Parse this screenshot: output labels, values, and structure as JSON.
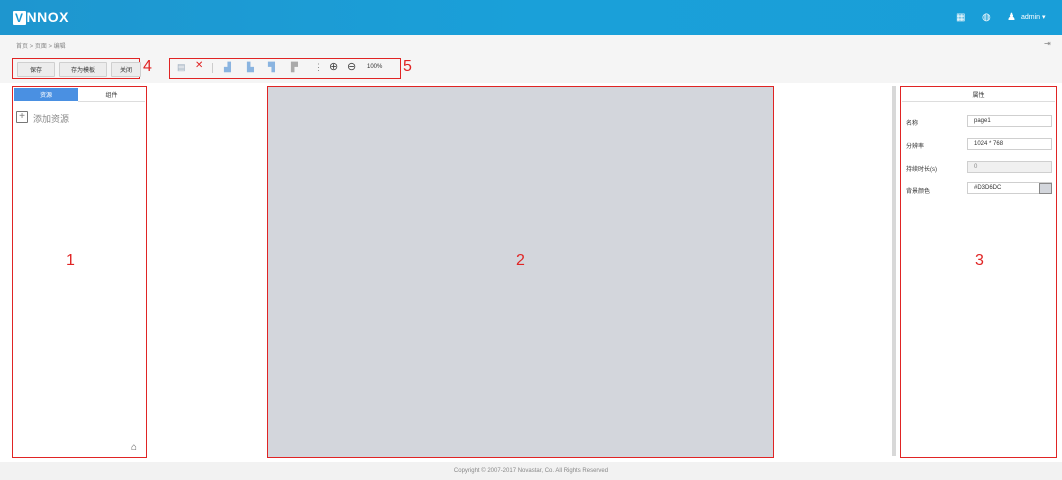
{
  "app": {
    "logo_prefix": "V",
    "logo_text": "NNOX",
    "user": "admin"
  },
  "breadcrumb": "首页 > 页面 > 编辑",
  "toolbar": {
    "save_label": "保存",
    "save_template_label": "存为模板",
    "close_label": "关闭",
    "zoom_level": "100%"
  },
  "left_panel": {
    "tabs": [
      {
        "label": "资源"
      },
      {
        "label": "组件"
      }
    ],
    "add_resource_label": "添加资源"
  },
  "right_panel": {
    "title": "属性",
    "props": [
      {
        "label": "名称",
        "value": "page1"
      },
      {
        "label": "分辨率",
        "value": "1024 * 768"
      },
      {
        "label": "持续时长(s)",
        "value": "0"
      },
      {
        "label": "背景颜色",
        "value": "#D3D6DC"
      }
    ]
  },
  "annotations": [
    "1",
    "2",
    "3",
    "4",
    "5"
  ],
  "footer": "Copyright © 2007-2017 Novastar, Co. All Rights Reserved",
  "colors": {
    "header": "#1a9bd6",
    "canvas_bg": "#D3D6DC",
    "tab_active": "#4a90e2",
    "annotation_red": "#e02424"
  }
}
